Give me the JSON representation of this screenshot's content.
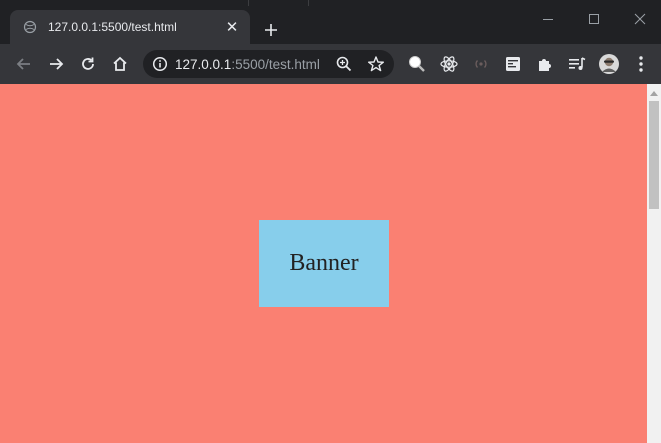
{
  "tab": {
    "title": "127.0.0.1:5500/test.html",
    "close_glyph": "✕",
    "favicon": "globe-icon"
  },
  "toolbar": {
    "url_host": "127.0.0.1",
    "url_rest": ":5500/test.html"
  },
  "page": {
    "background_color": "#fa8072",
    "banner": {
      "text": "Banner",
      "background_color": "#87ceeb"
    }
  },
  "extensions": [
    "search-extension-icon",
    "react-devtools-icon",
    "broadcast-icon",
    "reader-mode-icon",
    "extensions-puzzle-icon",
    "media-queue-icon",
    "profile-avatar",
    "more-menu-icon"
  ]
}
